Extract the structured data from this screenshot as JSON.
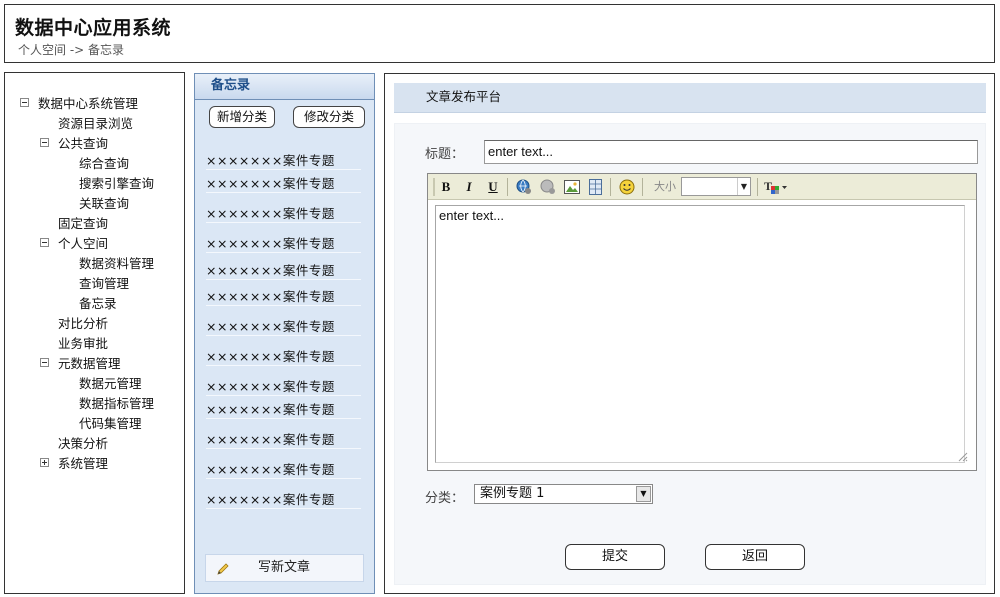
{
  "header": {
    "title": "数据中心应用系统",
    "breadcrumb": "个人空间 -> 备忘录"
  },
  "tree": {
    "items": [
      {
        "label": "数据中心系统管理",
        "toggle": "minus"
      },
      {
        "label": "资源目录浏览"
      },
      {
        "label": "公共查询",
        "toggle": "minus"
      },
      {
        "label": "综合查询"
      },
      {
        "label": "搜索引擎查询"
      },
      {
        "label": "关联查询"
      },
      {
        "label": "固定查询"
      },
      {
        "label": "个人空间",
        "toggle": "minus"
      },
      {
        "label": "数据资料管理"
      },
      {
        "label": "查询管理"
      },
      {
        "label": "备忘录"
      },
      {
        "label": "对比分析"
      },
      {
        "label": "业务审批"
      },
      {
        "label": "元数据管理",
        "toggle": "minus"
      },
      {
        "label": "数据元管理"
      },
      {
        "label": "数据指标管理"
      },
      {
        "label": "代码集管理"
      },
      {
        "label": "决策分析"
      },
      {
        "label": "系统管理",
        "toggle": "plus"
      }
    ]
  },
  "memo": {
    "title": "备忘录",
    "add_category": "新增分类",
    "edit_category": "修改分类",
    "items": [
      "×××××××案件专题",
      "×××××××案件专题",
      "×××××××案件专题",
      "×××××××案件专题",
      "×××××××案件专题",
      "×××××××案件专题",
      "×××××××案件专题",
      "×××××××案件专题",
      "×××××××案件专题",
      "×××××××案件专题",
      "×××××××案件专题",
      "×××××××案件专题",
      "×××××××案件专题"
    ],
    "write_new": "写新文章"
  },
  "panel": {
    "title": "文章发布平台",
    "title_label": "标题：",
    "title_value": "enter text...",
    "editor_text": "enter text...",
    "font_size_label": "大小",
    "category_label": "分类：",
    "category_value": "案例专题 1",
    "submit": "提交",
    "back": "返回"
  },
  "toolbar": {
    "bold": "B",
    "italic": "I",
    "underline": "U"
  }
}
